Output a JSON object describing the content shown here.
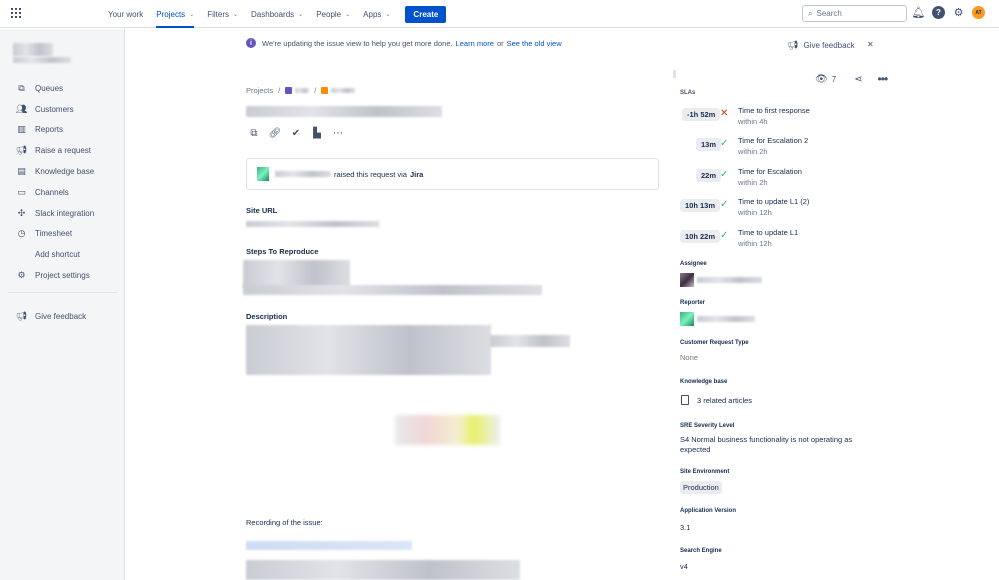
{
  "nav": {
    "items": [
      {
        "label": "Your work",
        "chevron": false,
        "active": false
      },
      {
        "label": "Projects",
        "chevron": true,
        "active": true
      },
      {
        "label": "Filters",
        "chevron": true,
        "active": false
      },
      {
        "label": "Dashboards",
        "chevron": true,
        "active": false
      },
      {
        "label": "People",
        "chevron": true,
        "active": false
      },
      {
        "label": "Apps",
        "chevron": true,
        "active": false
      }
    ],
    "create_label": "Create",
    "search_placeholder": "Search",
    "avatar_initials": "AT"
  },
  "sidebar": {
    "items": [
      {
        "label": "Queues",
        "icon": "queues-icon"
      },
      {
        "label": "Customers",
        "icon": "customers-icon"
      },
      {
        "label": "Reports",
        "icon": "reports-icon"
      },
      {
        "label": "Raise a request",
        "icon": "megaphone-icon"
      },
      {
        "label": "Knowledge base",
        "icon": "knowledge-base-icon"
      },
      {
        "label": "Channels",
        "icon": "channels-icon"
      },
      {
        "label": "Slack integration",
        "icon": "slack-icon"
      },
      {
        "label": "Timesheet",
        "icon": "timesheet-icon"
      },
      {
        "label": "Add shortcut",
        "icon": "add-shortcut-icon"
      },
      {
        "label": "Project settings",
        "icon": "gear-icon"
      }
    ],
    "feedback_label": "Give feedback"
  },
  "banner": {
    "text": "We're updating the issue view to help you get more done.",
    "learn_more": "Learn more",
    "or": "or",
    "old_view": "See the old view",
    "give_feedback": "Give feedback"
  },
  "issue": {
    "breadcrumb_projects": "Projects",
    "raised_text": "raised this request via",
    "raised_via": "Jira",
    "site_url_label": "Site URL",
    "steps_label": "Steps To Reproduce",
    "description_label": "Description",
    "recording_label": "Recording of the issue:"
  },
  "panel": {
    "watchers": "7",
    "sla_title": "SLAs",
    "slas": [
      {
        "time": "-1h 52m",
        "status": "breached",
        "name": "Time to first response",
        "goal": "within 4h"
      },
      {
        "time": "13m",
        "status": "met",
        "name": "Time for Escalation 2",
        "goal": "within 2h"
      },
      {
        "time": "22m",
        "status": "met",
        "name": "Time for Escalation",
        "goal": "within 2h"
      },
      {
        "time": "10h 13m",
        "status": "met",
        "name": "Time to update L1 (2)",
        "goal": "within 12h"
      },
      {
        "time": "10h 22m",
        "status": "met",
        "name": "Time to update L1",
        "goal": "within 12h"
      }
    ],
    "assignee_label": "Assignee",
    "reporter_label": "Reporter",
    "crt_label": "Customer Request Type",
    "crt_value": "None",
    "kb_label": "Knowledge base",
    "kb_value": "3 related articles",
    "sre_label": "SRE Severity Level",
    "sre_value": "S4 Normal business functionality is not operating as expected",
    "env_label": "Site Environment",
    "env_value": "Production",
    "app_version_label": "Application Version",
    "app_version_value": "3.1",
    "search_engine_label": "Search Engine",
    "search_engine_value": "v4"
  }
}
